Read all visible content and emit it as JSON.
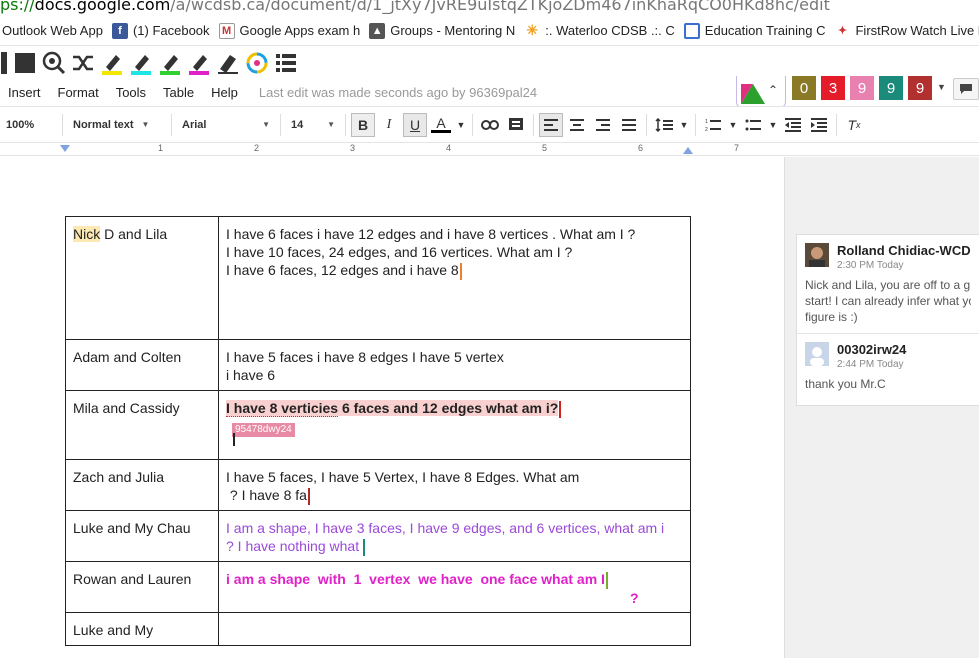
{
  "browser": {
    "url_scheme": "ps://",
    "url_host": "docs.google.com",
    "url_path": "/a/wcdsb.ca/document/d/1_jtXy7JvRE9uIstqZTKjoZDm467inKhaRqCO0HKd8hc/edit"
  },
  "bookmarks": [
    {
      "label": "Outlook Web App",
      "icon": "outlook-icon"
    },
    {
      "label": "(1) Facebook",
      "icon": "facebook-icon"
    },
    {
      "label": "Google Apps exam h",
      "icon": "gmail-icon"
    },
    {
      "label": "Groups - Mentoring N",
      "icon": "groups-icon"
    },
    {
      "label": ":. Waterloo CDSB .:. C",
      "icon": "waterloo-icon"
    },
    {
      "label": "Education Training C",
      "icon": "education-icon"
    },
    {
      "label": "FirstRow Watch Live M",
      "icon": "firstrow-icon"
    }
  ],
  "menu": {
    "items": [
      "Insert",
      "Format",
      "Tools",
      "Table",
      "Help"
    ],
    "last_edit": "Last edit was made seconds ago by 96369pal24"
  },
  "collaborators": [
    {
      "label": "0",
      "color": "#8a7a26"
    },
    {
      "label": "3",
      "color": "#e41c2a"
    },
    {
      "label": "9",
      "color": "#e880b0"
    },
    {
      "label": "9",
      "color": "#1a8a7a"
    },
    {
      "label": "9",
      "color": "#b23030"
    }
  ],
  "toolbar": {
    "zoom": "100%",
    "style": "Normal text",
    "font": "Arial",
    "size": "14"
  },
  "ruler": {
    "numbers": [
      "1",
      "2",
      "3",
      "4",
      "5",
      "6",
      "7"
    ]
  },
  "table": {
    "rows": [
      {
        "name_hl": "Nick",
        "name_rest": " D and Lila",
        "lines": [
          "I have 6 faces i have 12 edges and i have 8 vertices . What am I ?",
          "I have 10 faces, 24 edges, and 16 vertices. What am I ?",
          "I have 6 faces, 12 edges and i  have 8"
        ]
      },
      {
        "name": "Adam and Colten",
        "lines": [
          "I have 5 faces i have 8 edges I have 5 vertex",
          "i have 6"
        ]
      },
      {
        "name": "Mila and Cassidy",
        "line_a": "I have 8 verticies",
        "line_b": " 6 faces and 12 edges what am i?",
        "tag": "95478dwy24"
      },
      {
        "name": "Zach and Julia",
        "lines": [
          "I have 5 faces, I have 5 Vertex, I have 8 Edges. What am",
          " ? I have 8 fa"
        ]
      },
      {
        "name": "Luke and My Chau",
        "lines": [
          "I am a shape, I have 3 faces, I have 9 edges, and 6 vertices, what am i",
          "? I have nothing what"
        ]
      },
      {
        "name": "Rowan and Lauren",
        "line_a": "i am a shape  with  1  vertex  we have  one face what am I",
        "line_b": "?"
      },
      {
        "name": "Luke and My",
        "lines": []
      }
    ]
  },
  "comments": [
    {
      "author": "Rolland Chidiac-WCDSB",
      "time": "2:30 PM Today",
      "body": [
        "Nick and Lila, you are off to a great",
        "start! I can already infer what your",
        "figure is :)"
      ]
    },
    {
      "author": "00302irw24",
      "time": "2:44 PM Today",
      "body": [
        "thank you Mr.C"
      ]
    }
  ],
  "colors": {
    "accent_purple": "#9a4ad8",
    "accent_magenta": "#e020c8",
    "highlight_yellow": "#fce8b2",
    "highlight_pink": "#f8d0d0"
  }
}
